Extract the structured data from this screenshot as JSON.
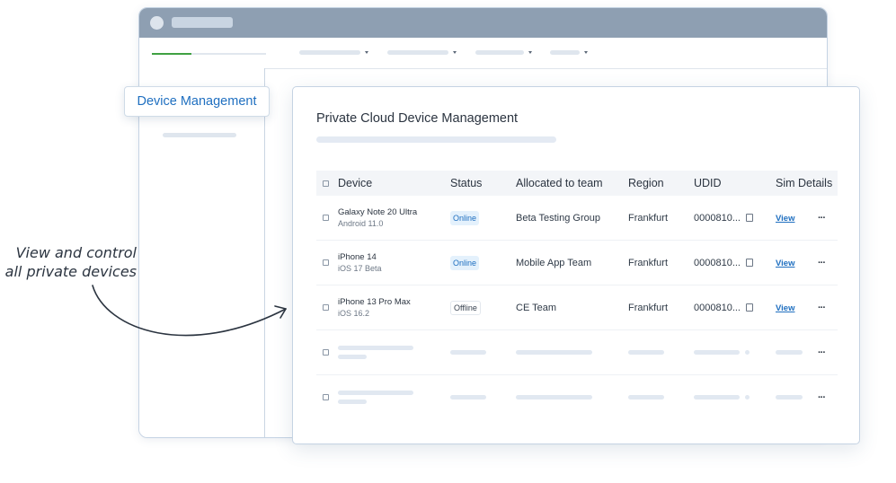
{
  "sidebar_tag": "Device Management",
  "panel": {
    "title": "Private Cloud Device Management"
  },
  "table": {
    "headers": [
      "Device",
      "Status",
      "Allocated to team",
      "Region",
      "UDID",
      "Sim Details"
    ],
    "rows": [
      {
        "device": "Galaxy Note 20 Ultra",
        "os": "Android 11.0",
        "status": "Online",
        "team": "Beta Testing Group",
        "region": "Frankfurt",
        "udid": "0000810...",
        "sim": "View",
        "more": "···"
      },
      {
        "device": "iPhone 14",
        "os": "iOS 17 Beta",
        "status": "Online",
        "team": "Mobile App Team",
        "region": "Frankfurt",
        "udid": "0000810...",
        "sim": "View",
        "more": "···"
      },
      {
        "device": "iPhone 13 Pro Max",
        "os": "iOS 16.2",
        "status": "Offline",
        "team": "CE Team",
        "region": "Frankfurt",
        "udid": "0000810...",
        "sim": "View",
        "more": "···"
      }
    ],
    "placeholder_more": "···"
  },
  "progress": {
    "value": 0.35
  },
  "annotation": {
    "line1": "View and control",
    "line2": "all private devices"
  },
  "icons": {
    "checkbox": "checkbox-icon",
    "copy": "copy-icon",
    "more": "more-icon",
    "dropdown": "caret-down-icon",
    "arrow": "curved-arrow-icon"
  },
  "colors": {
    "accent": "#1f6fc0",
    "online_bg": "#e4f1fc",
    "progress": "#3fa142",
    "titlebar": "#8e9fb2"
  }
}
